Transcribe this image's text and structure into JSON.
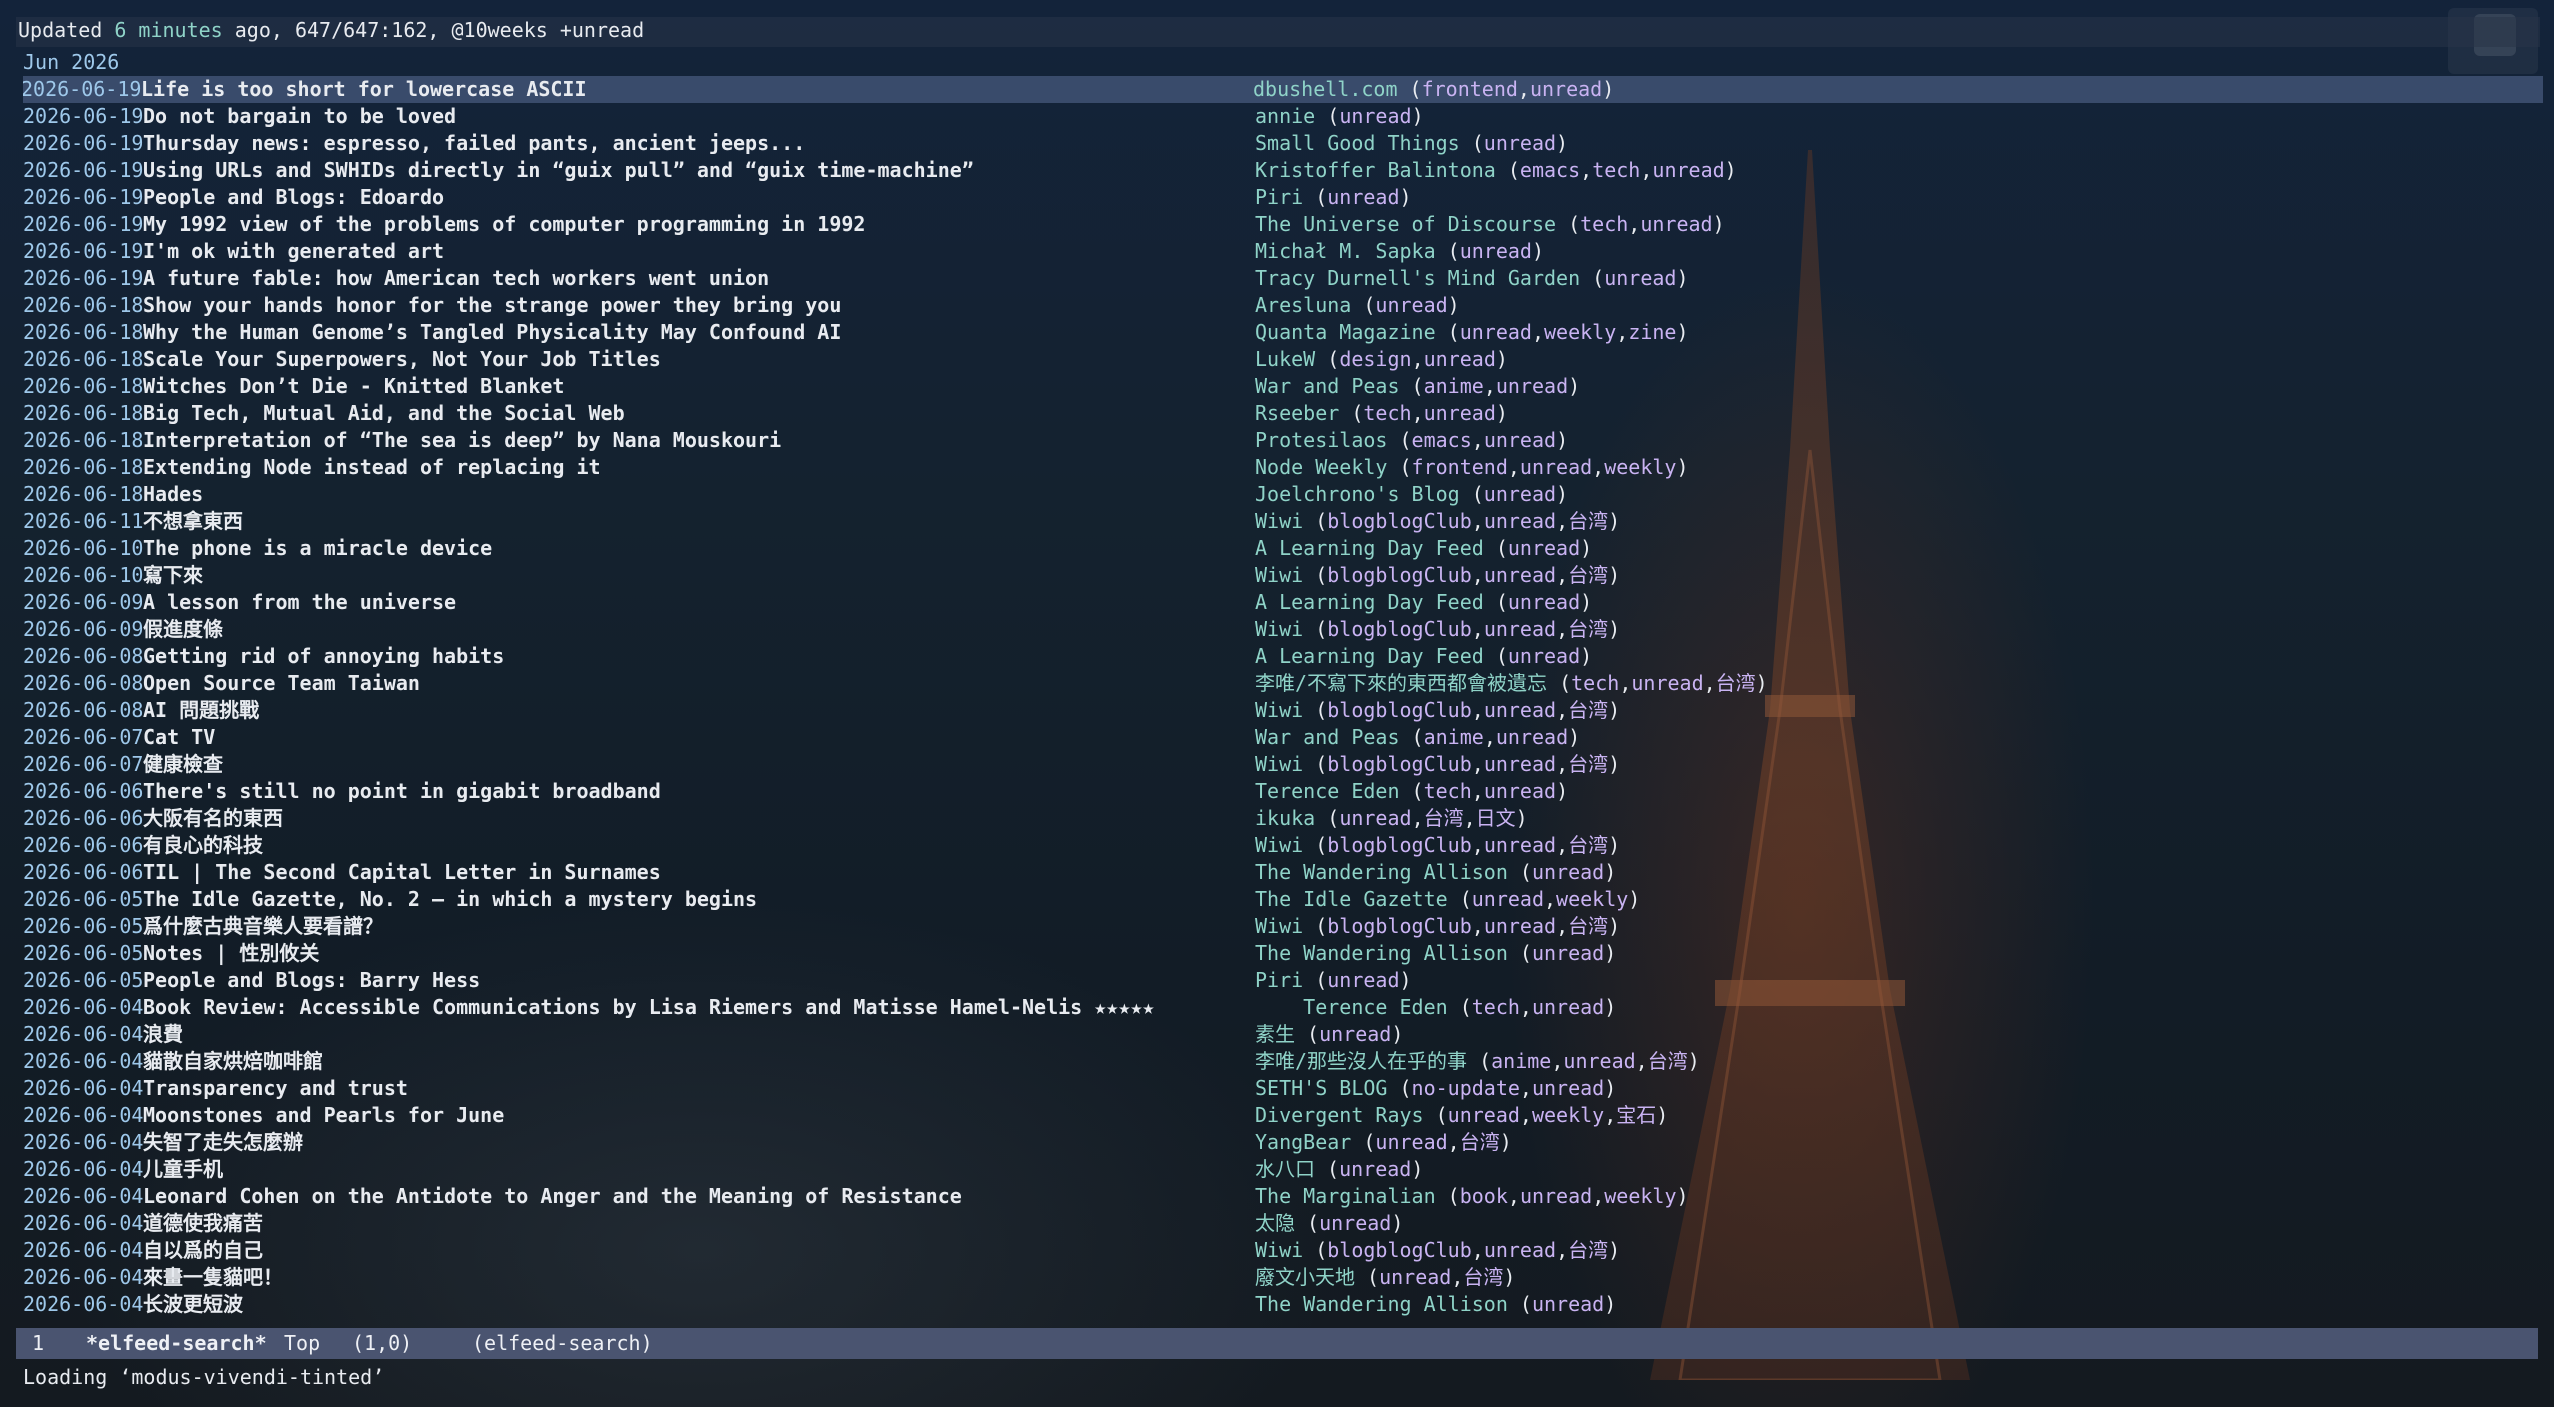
{
  "header": {
    "prefix": "Updated ",
    "age": "6 minutes",
    "suffix": " ago, 647/647:162, @10weeks +unread"
  },
  "month_label": "Jun 2026",
  "entries": [
    {
      "date": "2026-06-19",
      "title": "Life is too short for lowercase ASCII",
      "feed": "dbushell.com",
      "tags": [
        "frontend",
        "unread"
      ],
      "selected": true
    },
    {
      "date": "2026-06-19",
      "title": "Do not bargain to be loved",
      "feed": "annie",
      "tags": [
        "unread"
      ]
    },
    {
      "date": "2026-06-19",
      "title": "Thursday news: espresso, failed pants, ancient jeeps...",
      "feed": "Small Good Things",
      "tags": [
        "unread"
      ]
    },
    {
      "date": "2026-06-19",
      "title": "Using URLs and SWHIDs directly in “guix pull” and “guix time-machine”",
      "feed": "Kristoffer Balintona",
      "tags": [
        "emacs",
        "tech",
        "unread"
      ]
    },
    {
      "date": "2026-06-19",
      "title": "People and Blogs: Edoardo",
      "feed": "Piri",
      "tags": [
        "unread"
      ]
    },
    {
      "date": "2026-06-19",
      "title": "My 1992 view of the problems of computer programming in 1992",
      "feed": "The Universe of Discourse",
      "tags": [
        "tech",
        "unread"
      ]
    },
    {
      "date": "2026-06-19",
      "title": "I'm ok with generated art",
      "feed": "Michał M. Sapka",
      "tags": [
        "unread"
      ]
    },
    {
      "date": "2026-06-19",
      "title": "A future fable: how American tech workers went union",
      "feed": "Tracy Durnell's Mind Garden",
      "tags": [
        "unread"
      ]
    },
    {
      "date": "2026-06-18",
      "title": "Show your hands honor for the strange power they bring you",
      "feed": "Aresluna",
      "tags": [
        "unread"
      ]
    },
    {
      "date": "2026-06-18",
      "title": "Why the Human Genome’s Tangled Physicality May Confound AI",
      "feed": "Quanta Magazine",
      "tags": [
        "unread",
        "weekly",
        "zine"
      ]
    },
    {
      "date": "2026-06-18",
      "title": "Scale Your Superpowers, Not Your Job Titles",
      "feed": "LukeW",
      "tags": [
        "design",
        "unread"
      ]
    },
    {
      "date": "2026-06-18",
      "title": "Witches Don’t Die - Knitted Blanket",
      "feed": "War and Peas",
      "tags": [
        "anime",
        "unread"
      ]
    },
    {
      "date": "2026-06-18",
      "title": "Big Tech, Mutual Aid, and the Social Web",
      "feed": "Rseeber",
      "tags": [
        "tech",
        "unread"
      ]
    },
    {
      "date": "2026-06-18",
      "title": "Interpretation of “The sea is deep” by Nana Mouskouri",
      "feed": "Protesilaos",
      "tags": [
        "emacs",
        "unread"
      ]
    },
    {
      "date": "2026-06-18",
      "title": "Extending Node instead of replacing it",
      "feed": "Node Weekly",
      "tags": [
        "frontend",
        "unread",
        "weekly"
      ]
    },
    {
      "date": "2026-06-18",
      "title": "Hades",
      "feed": "Joelchrono's Blog",
      "tags": [
        "unread"
      ]
    },
    {
      "date": "2026-06-11",
      "title": "不想拿東西",
      "feed": "Wiwi",
      "tags": [
        "blogblogClub",
        "unread",
        "台湾"
      ]
    },
    {
      "date": "2026-06-10",
      "title": "The phone is a miracle device",
      "feed": "A Learning Day Feed",
      "tags": [
        "unread"
      ]
    },
    {
      "date": "2026-06-10",
      "title": "寫下來",
      "feed": "Wiwi",
      "tags": [
        "blogblogClub",
        "unread",
        "台湾"
      ]
    },
    {
      "date": "2026-06-09",
      "title": "A lesson from the universe",
      "feed": "A Learning Day Feed",
      "tags": [
        "unread"
      ]
    },
    {
      "date": "2026-06-09",
      "title": "假進度條",
      "feed": "Wiwi",
      "tags": [
        "blogblogClub",
        "unread",
        "台湾"
      ]
    },
    {
      "date": "2026-06-08",
      "title": "Getting rid of annoying habits",
      "feed": "A Learning Day Feed",
      "tags": [
        "unread"
      ]
    },
    {
      "date": "2026-06-08",
      "title": "Open Source Team Taiwan",
      "feed": "李唯/不寫下來的東西都會被遺忘",
      "tags": [
        "tech",
        "unread",
        "台湾"
      ]
    },
    {
      "date": "2026-06-08",
      "title": "AI 問題挑戰",
      "feed": "Wiwi",
      "tags": [
        "blogblogClub",
        "unread",
        "台湾"
      ]
    },
    {
      "date": "2026-06-07",
      "title": "Cat TV",
      "feed": "War and Peas",
      "tags": [
        "anime",
        "unread"
      ]
    },
    {
      "date": "2026-06-07",
      "title": "健康檢查",
      "feed": "Wiwi",
      "tags": [
        "blogblogClub",
        "unread",
        "台湾"
      ]
    },
    {
      "date": "2026-06-06",
      "title": "There's still no point in gigabit broadband",
      "feed": "Terence Eden",
      "tags": [
        "tech",
        "unread"
      ]
    },
    {
      "date": "2026-06-06",
      "title": "大阪有名的東西",
      "feed": "ikuka",
      "tags": [
        "unread",
        "台湾",
        "日文"
      ]
    },
    {
      "date": "2026-06-06",
      "title": "有良心的科技",
      "feed": "Wiwi",
      "tags": [
        "blogblogClub",
        "unread",
        "台湾"
      ]
    },
    {
      "date": "2026-06-06",
      "title": "TIL | The Second Capital Letter in Surnames",
      "feed": "The Wandering Allison",
      "tags": [
        "unread"
      ]
    },
    {
      "date": "2026-06-05",
      "title": "The Idle Gazette, No. 2 — in which a mystery begins",
      "feed": "The Idle Gazette",
      "tags": [
        "unread",
        "weekly"
      ]
    },
    {
      "date": "2026-06-05",
      "title": "爲什麼古典音樂人要看譜？",
      "feed": "Wiwi",
      "tags": [
        "blogblogClub",
        "unread",
        "台湾"
      ]
    },
    {
      "date": "2026-06-05",
      "title": "Notes | 性別攸关",
      "feed": "The Wandering Allison",
      "tags": [
        "unread"
      ]
    },
    {
      "date": "2026-06-05",
      "title": "People and Blogs: Barry Hess",
      "feed": "Piri",
      "tags": [
        "unread"
      ]
    },
    {
      "date": "2026-06-04",
      "title": "Book Review: Accessible Communications by Lisa Riemers and Matisse Hamel-Nelis ★★★★★",
      "feed": "    Terence Eden",
      "tags": [
        "tech",
        "unread"
      ]
    },
    {
      "date": "2026-06-04",
      "title": "浪費",
      "feed": "素生",
      "tags": [
        "unread"
      ]
    },
    {
      "date": "2026-06-04",
      "title": "貓散自家烘焙咖啡館",
      "feed": "李唯/那些沒人在乎的事",
      "tags": [
        "anime",
        "unread",
        "台湾"
      ]
    },
    {
      "date": "2026-06-04",
      "title": "Transparency and trust",
      "feed": "SETH'S BLOG",
      "tags": [
        "no-update",
        "unread"
      ]
    },
    {
      "date": "2026-06-04",
      "title": "Moonstones and Pearls for June",
      "feed": "Divergent Rays",
      "tags": [
        "unread",
        "weekly",
        "宝石"
      ]
    },
    {
      "date": "2026-06-04",
      "title": "失智了走失怎麼辦",
      "feed": "YangBear",
      "tags": [
        "unread",
        "台湾"
      ]
    },
    {
      "date": "2026-06-04",
      "title": "儿童手机",
      "feed": "水八口",
      "tags": [
        "unread"
      ]
    },
    {
      "date": "2026-06-04",
      "title": "Leonard Cohen on the Antidote to Anger and the Meaning of Resistance",
      "feed": "The Marginalian",
      "tags": [
        "book",
        "unread",
        "weekly"
      ]
    },
    {
      "date": "2026-06-04",
      "title": "道德使我痛苦",
      "feed": "太隐",
      "tags": [
        "unread"
      ]
    },
    {
      "date": "2026-06-04",
      "title": "自以爲的自己",
      "feed": "Wiwi",
      "tags": [
        "blogblogClub",
        "unread",
        "台湾"
      ]
    },
    {
      "date": "2026-06-04",
      "title": "來畫一隻貓吧！",
      "feed": "廢文小天地",
      "tags": [
        "unread",
        "台湾"
      ]
    },
    {
      "date": "2026-06-04",
      "title": "长波更短波",
      "feed": "The Wandering Allison",
      "tags": [
        "unread"
      ]
    }
  ],
  "modeline": {
    "window_number": "1",
    "buffer_name": "*elfeed-search*",
    "position": "Top",
    "line_col": "(1,0)",
    "mode": "(elfeed-search)"
  },
  "echo_area": "Loading ‘modus-vivendi-tinted’",
  "colors": {
    "date": "#9ec8ea",
    "feed": "#8fd3c8",
    "tag": "#c9b3f2",
    "selection": "#5a6e96",
    "modeline": "#4a5470"
  }
}
